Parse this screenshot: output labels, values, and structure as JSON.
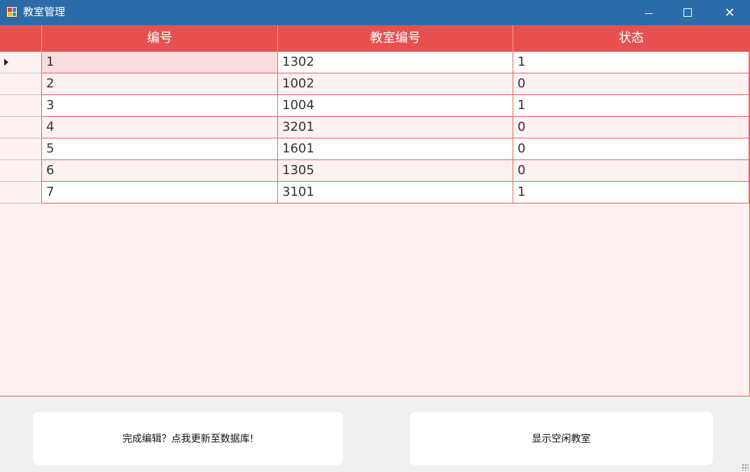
{
  "window": {
    "title": "教室管理",
    "controls": {
      "minimize": "—",
      "maximize": "",
      "close": "✕"
    }
  },
  "colors": {
    "titlebar": "#2b6ca8",
    "header": "#e84f4f",
    "grid_border": "#e8625f",
    "row_alt": "#fdf1f1"
  },
  "table": {
    "columns": [
      "编号",
      "教室编号",
      "状态"
    ],
    "rows": [
      [
        "1",
        "1302",
        "1"
      ],
      [
        "2",
        "1002",
        "0"
      ],
      [
        "3",
        "1004",
        "1"
      ],
      [
        "4",
        "3201",
        "0"
      ],
      [
        "5",
        "1601",
        "0"
      ],
      [
        "6",
        "1305",
        "0"
      ],
      [
        "7",
        "3101",
        "1"
      ]
    ],
    "current_row_indicator_icon": "triangle-right-icon"
  },
  "buttons": {
    "update_db": "完成编辑？点我更新至数据库!",
    "show_free": "显示空闲教室"
  }
}
